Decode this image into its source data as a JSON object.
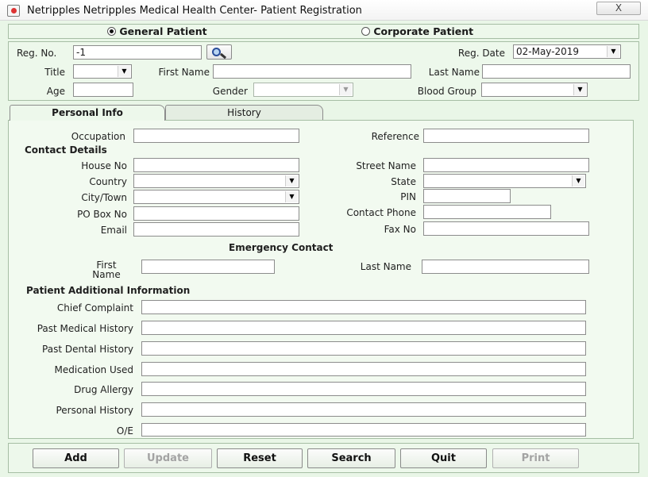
{
  "window": {
    "title": "Netripples Netripples Medical Health Center- Patient Registration",
    "close_label": "X"
  },
  "patient_type": {
    "general_label": "General Patient",
    "corporate_label": "Corporate Patient",
    "selected": "general"
  },
  "registration": {
    "reg_no_label": "Reg. No.",
    "reg_no_value": "-1",
    "reg_date_label": "Reg. Date",
    "reg_date_value": "02-May-2019",
    "title_label": "Title",
    "title_value": "",
    "first_name_label": "First Name",
    "first_name_value": "",
    "last_name_label": "Last Name",
    "last_name_value": "",
    "age_label": "Age",
    "age_value": "",
    "gender_label": "Gender",
    "gender_value": "",
    "blood_group_label": "Blood Group",
    "blood_group_value": ""
  },
  "tabs": [
    {
      "label": "Personal Info",
      "active": true
    },
    {
      "label": "History",
      "active": false
    }
  ],
  "personal": {
    "occupation_label": "Occupation",
    "reference_label": "Reference",
    "contact_details_heading": "Contact Details",
    "house_no_label": "House No",
    "street_name_label": "Street Name",
    "country_label": "Country",
    "state_label": "State",
    "city_label": "City/Town",
    "pin_label": "PIN",
    "po_box_label": "PO Box No",
    "contact_phone_label": "Contact Phone",
    "email_label": "Email",
    "fax_label": "Fax No",
    "emergency_heading": "Emergency Contact",
    "em_first_name_label_1": "First",
    "em_first_name_label_2": "Name",
    "em_last_name_label": "Last Name",
    "additional_heading": "Patient Additional Information",
    "chief_complaint_label": "Chief Complaint",
    "past_medical_label": "Past Medical History",
    "past_dental_label": "Past Dental History",
    "medication_label": "Medication Used",
    "drug_allergy_label": "Drug Allergy",
    "personal_history_label": "Personal History",
    "oe_label": "O/E"
  },
  "buttons": {
    "add": "Add",
    "update": "Update",
    "reset": "Reset",
    "search": "Search",
    "quit": "Quit",
    "print": "Print"
  },
  "icons": {
    "app": "hospital-app-icon",
    "search": "magnifier-icon",
    "dropdown": "down-arrow-icon"
  },
  "colors": {
    "window_bg": "#e9f6e7",
    "panel_border": "#a6bea4"
  }
}
